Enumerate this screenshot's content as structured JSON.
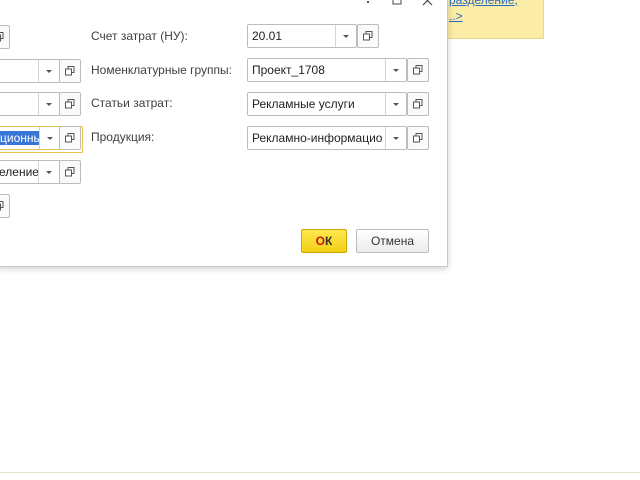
{
  "hint": {
    "line1": "разделение,",
    "line2": "..>"
  },
  "window": {
    "menu_icon": "more-vertical-icon",
    "maximize_icon": "maximize-icon",
    "close_icon": "close-icon"
  },
  "left_column": {
    "field3_partial": "ционны",
    "field4_partial": "еление"
  },
  "form": {
    "cost_account_label": "Счет затрат (НУ):",
    "cost_account_value": "20.01",
    "nomenclature_groups_label": "Номенклатурные группы:",
    "nomenclature_groups_value": "Проект_1708",
    "cost_items_label": "Статьи затрат:",
    "cost_items_value": "Рекламные услуги",
    "products_label": "Продукция:",
    "products_value": "Рекламно-информацио"
  },
  "buttons": {
    "ok_prefix": "О",
    "ok_suffix": "К",
    "cancel": "Отмена"
  },
  "colors": {
    "ok_button": "#f5d317",
    "focus_border": "#e8c552",
    "hint_background": "#fbeca6",
    "link": "#2a6bc4"
  }
}
